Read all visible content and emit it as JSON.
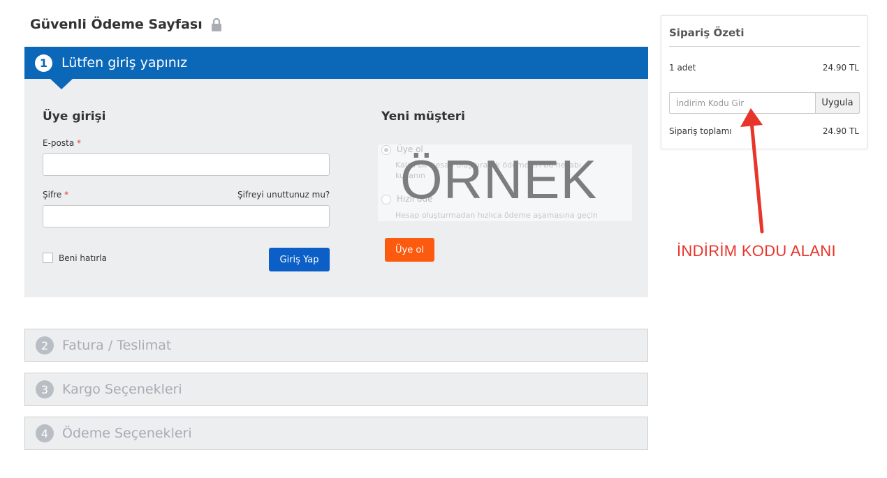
{
  "page": {
    "title": "Güvenli Ödeme Sayfası",
    "lock_icon": "lock-icon"
  },
  "step1": {
    "number": "1",
    "title": "Lütfen giriş yapınız",
    "member_login": {
      "title": "Üye girişi",
      "email_label": "E-posta",
      "email_value": "",
      "password_label": "Şifre",
      "password_value": "",
      "required_mark": "*",
      "forgot_password": "Şifreyi unuttunuz mu?",
      "remember_me": "Beni hatırla",
      "login_button": "Giriş Yap"
    },
    "new_customer": {
      "title": "Yeni müşteri",
      "option1_label": "Üye ol",
      "option1_desc_line1": "Kalıcı bir hesap oluşturarak ödemeleri bu hesabı",
      "option1_desc_line2": "kullanın",
      "option2_label": "Hızlı öde",
      "option2_desc": "Hesap oluşturmadan hızlıca ödeme aşamasına geçin",
      "watermark": "ÖRNEK",
      "register_button": "Üye ol"
    }
  },
  "steps": [
    {
      "number": "2",
      "title": "Fatura / Teslimat"
    },
    {
      "number": "3",
      "title": "Kargo Seçenekleri"
    },
    {
      "number": "4",
      "title": "Ödeme Seçenekleri"
    }
  ],
  "summary": {
    "title": "Sipariş Özeti",
    "quantity": "1 adet",
    "item_price": "24.90 TL",
    "coupon_placeholder": "İndirim Kodu Gir",
    "apply_button": "Uygula",
    "total_label": "Sipariş toplamı",
    "total_value": "24.90 TL"
  },
  "annotation": {
    "text": "İNDİRİM KODU ALANI",
    "color": "#e7352b"
  },
  "colors": {
    "primary": "#0b67b8",
    "login_button": "#0b5fc6",
    "register_button": "#fb5a0f",
    "panel_bg": "#edeef0"
  }
}
